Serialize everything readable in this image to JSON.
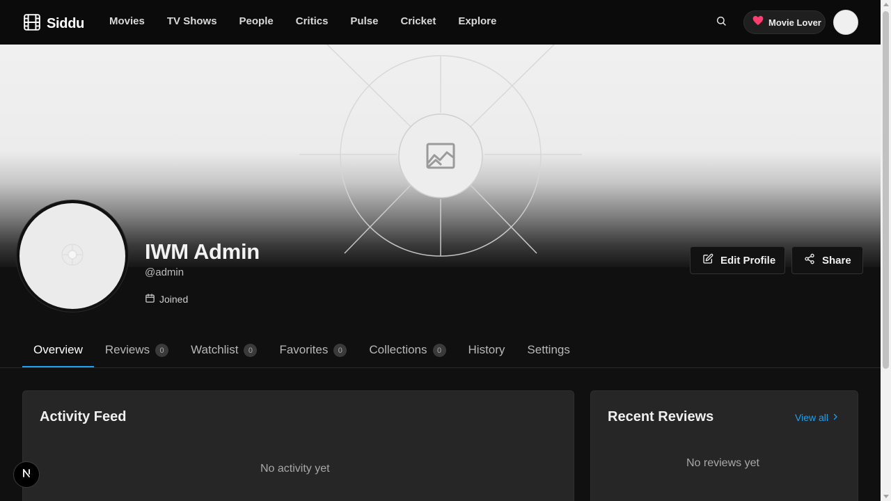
{
  "app": {
    "logo_text": "Siddu"
  },
  "nav": {
    "items": [
      "Movies",
      "TV Shows",
      "People",
      "Critics",
      "Pulse",
      "Cricket",
      "Explore"
    ]
  },
  "header": {
    "badge_label": "Movie Lover"
  },
  "profile": {
    "name": "IWM Admin",
    "handle": "@admin",
    "joined_label": "Joined",
    "edit_label": "Edit Profile",
    "share_label": "Share"
  },
  "tabs": [
    {
      "label": "Overview",
      "count": null,
      "active": true
    },
    {
      "label": "Reviews",
      "count": "0",
      "active": false
    },
    {
      "label": "Watchlist",
      "count": "0",
      "active": false
    },
    {
      "label": "Favorites",
      "count": "0",
      "active": false
    },
    {
      "label": "Collections",
      "count": "0",
      "active": false
    },
    {
      "label": "History",
      "count": null,
      "active": false
    },
    {
      "label": "Settings",
      "count": null,
      "active": false
    }
  ],
  "activity": {
    "title": "Activity Feed",
    "empty": "No activity yet"
  },
  "reviews": {
    "title": "Recent Reviews",
    "view_all": "View all",
    "empty": "No reviews yet"
  },
  "colors": {
    "accent": "#1da1f2",
    "heart": "#ff3d6e",
    "background": "#101010"
  },
  "icons": {
    "logo": "film-icon",
    "search": "search-icon",
    "badge": "heart-icon",
    "edit": "edit-icon",
    "share": "share-icon",
    "joined": "calendar-icon",
    "banner": "image-placeholder-icon",
    "view_all": "chevron-right-icon",
    "dev": "nextjs-icon"
  }
}
